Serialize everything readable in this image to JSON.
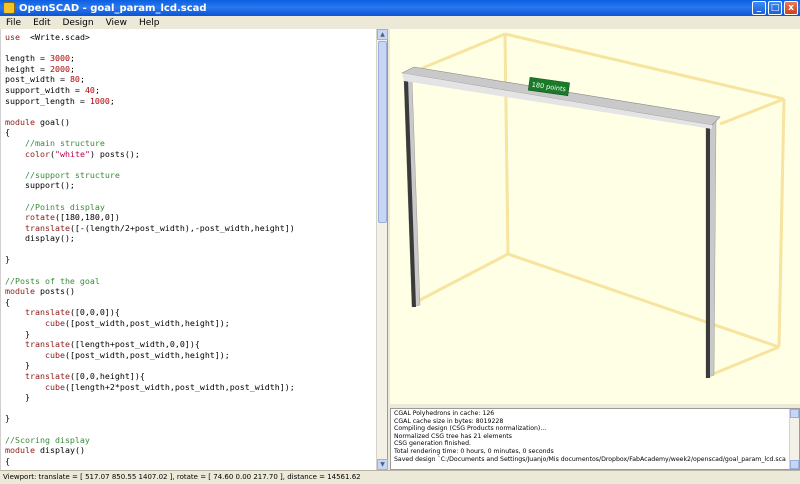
{
  "window": {
    "title": "OpenSCAD - goal_param_lcd.scad",
    "minimize": "_",
    "maximize": "□",
    "close": "x"
  },
  "menu": [
    "File",
    "Edit",
    "Design",
    "View",
    "Help"
  ],
  "editor": {
    "lines": [
      [
        [
          "kw",
          "use"
        ],
        [
          "",
          "  <Write.scad>"
        ]
      ],
      [],
      [
        [
          "",
          "length = "
        ],
        [
          "num",
          "3000"
        ],
        [
          "",
          ";"
        ]
      ],
      [
        [
          "",
          "height = "
        ],
        [
          "num",
          "2000"
        ],
        [
          "",
          ";"
        ]
      ],
      [
        [
          "",
          "post_width = "
        ],
        [
          "num",
          "80"
        ],
        [
          "",
          ";"
        ]
      ],
      [
        [
          "",
          "support_width = "
        ],
        [
          "num",
          "40"
        ],
        [
          "",
          ";"
        ]
      ],
      [
        [
          "",
          "support_length = "
        ],
        [
          "num",
          "1000"
        ],
        [
          "",
          ";"
        ]
      ],
      [],
      [
        [
          "kw",
          "module"
        ],
        [
          "",
          " goal()"
        ]
      ],
      [
        [
          "",
          "{"
        ]
      ],
      [
        [
          "cm",
          "    //main structure"
        ]
      ],
      [
        [
          "kw",
          "    color"
        ],
        [
          "",
          "("
        ],
        [
          "str",
          "\"white\""
        ],
        [
          "",
          ") posts();"
        ]
      ],
      [],
      [
        [
          "cm",
          "    //support structure"
        ]
      ],
      [
        [
          "",
          "    support();"
        ]
      ],
      [],
      [
        [
          "cm",
          "    //Points display"
        ]
      ],
      [
        [
          "kw",
          "    rotate"
        ],
        [
          "",
          "([180,180,0])"
        ]
      ],
      [
        [
          "kw",
          "    translate"
        ],
        [
          "",
          "([-(length/2+post_width),-post_width,height])"
        ]
      ],
      [
        [
          "",
          "    display();"
        ]
      ],
      [],
      [
        [
          "",
          "}"
        ]
      ],
      [],
      [
        [
          "cm",
          "//Posts of the goal"
        ]
      ],
      [
        [
          "kw",
          "module"
        ],
        [
          "",
          " posts()"
        ]
      ],
      [
        [
          "",
          "{"
        ]
      ],
      [
        [
          "kw",
          "    translate"
        ],
        [
          "",
          "([0,0,0]){"
        ]
      ],
      [
        [
          "kw",
          "        cube"
        ],
        [
          "",
          "([post_width,post_width,height]);"
        ]
      ],
      [
        [
          "",
          "    }"
        ]
      ],
      [
        [
          "kw",
          "    translate"
        ],
        [
          "",
          "([length+post_width,0,0]){"
        ]
      ],
      [
        [
          "kw",
          "        cube"
        ],
        [
          "",
          "([post_width,post_width,height]);"
        ]
      ],
      [
        [
          "",
          "    }"
        ]
      ],
      [
        [
          "kw",
          "    translate"
        ],
        [
          "",
          "([0,0,height]){"
        ]
      ],
      [
        [
          "kw",
          "        cube"
        ],
        [
          "",
          "([length+2*post_width,post_width,post_width]);"
        ]
      ],
      [
        [
          "",
          "    }"
        ]
      ],
      [],
      [
        [
          "",
          "}"
        ]
      ],
      [],
      [
        [
          "cm",
          "//Scoring display"
        ]
      ],
      [
        [
          "kw",
          "module"
        ],
        [
          "",
          " display()"
        ]
      ],
      [
        [
          "",
          "{"
        ]
      ]
    ]
  },
  "scene": {
    "score_label": "180 points",
    "post_color": "#c8c8c8",
    "support_color": "#f6e4a0",
    "label_color": "#1a7a2a"
  },
  "console": {
    "lines": [
      "CGAL Polyhedrons in cache: 126",
      "CGAL cache size in bytes: 8019228",
      "Compiling design (CSG Products normalization)...",
      "Normalized CSG tree has 21 elements",
      "CSG generation finished.",
      "Total rendering time: 0 hours, 0 minutes, 0 seconds",
      "Saved design `C:/Documents and Settings/Juanjo/Mis documentos/Dropbox/FabAcademy/week2/openscad/goal_param_lcd.scad'."
    ]
  },
  "status": {
    "text": "Viewport: translate = [ 517.07 850.55 1407.02 ], rotate = [ 74.60 0.00 217.70 ], distance = 14561.62"
  }
}
